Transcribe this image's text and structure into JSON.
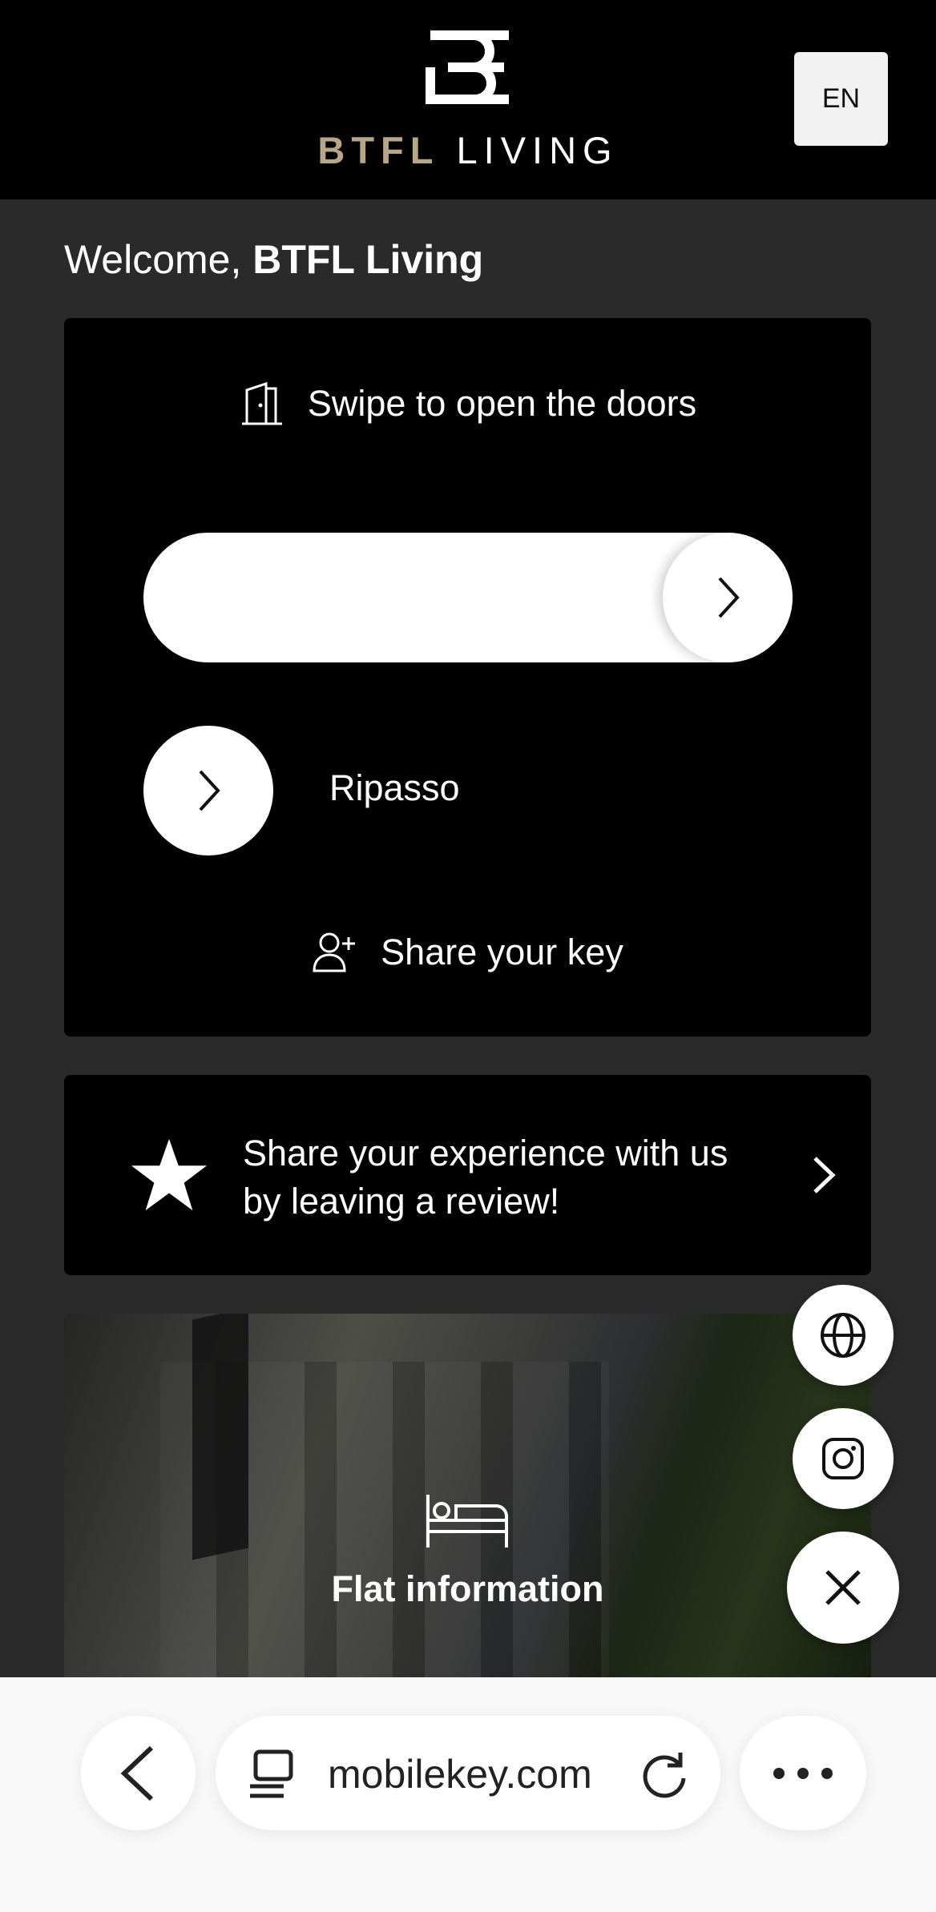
{
  "header": {
    "brand_part1": "BTFL",
    "brand_part2": "LIVING",
    "logo_icon": "btfl-logo-mark",
    "language_button": "EN"
  },
  "welcome": {
    "greeting": "Welcome,",
    "name": "BTFL Living"
  },
  "door_card": {
    "title": "Swipe to open the doors",
    "title_icon": "door-icon",
    "swipe_icon": "chevron-right-icon",
    "door_name": "Ripasso",
    "share_key_label": "Share your key",
    "share_key_icon": "add-user-icon"
  },
  "review_card": {
    "text": "Share your experience with us by leaving a review!",
    "icon": "star-icon",
    "chevron_icon": "chevron-right-icon"
  },
  "flat_card": {
    "label": "Flat information",
    "icon": "bed-icon"
  },
  "fabs": {
    "website_icon": "globe-icon",
    "instagram_icon": "instagram-icon",
    "close_icon": "close-icon"
  },
  "browser": {
    "url": "mobilekey.com",
    "back_icon": "chevron-left-icon",
    "tabs_icon": "tabs-icon",
    "reload_icon": "reload-icon",
    "more_icon": "more-dots-icon"
  },
  "colors": {
    "header_bg": "#000000",
    "page_bg": "#2a2a2a",
    "brand_gold": "#b8a787",
    "card_bg": "#000000",
    "browser_bar_bg": "#f8f8f8"
  }
}
